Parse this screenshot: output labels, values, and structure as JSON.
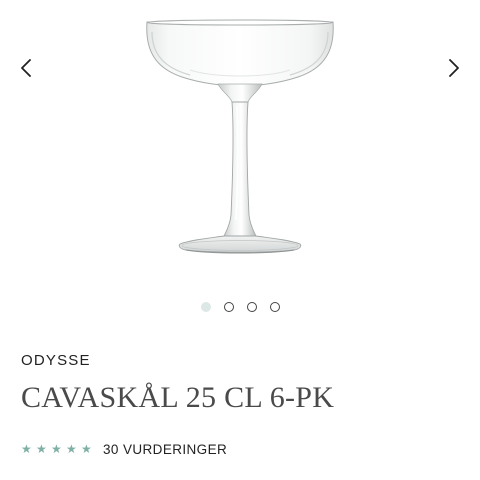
{
  "product": {
    "brand": "ODYSSE",
    "title": "CAVASKÅL 25 CL 6-PK",
    "rating": 5,
    "max_rating": 5,
    "reviews_label": "30 VURDERINGER"
  },
  "gallery": {
    "image_count": 4,
    "active_index": 0,
    "prev_icon": "chevron-left-icon",
    "next_icon": "chevron-right-icon"
  },
  "colors": {
    "star": "#7fb0a6",
    "active_dot": "#dce8e6",
    "title": "#4a4a4a"
  }
}
